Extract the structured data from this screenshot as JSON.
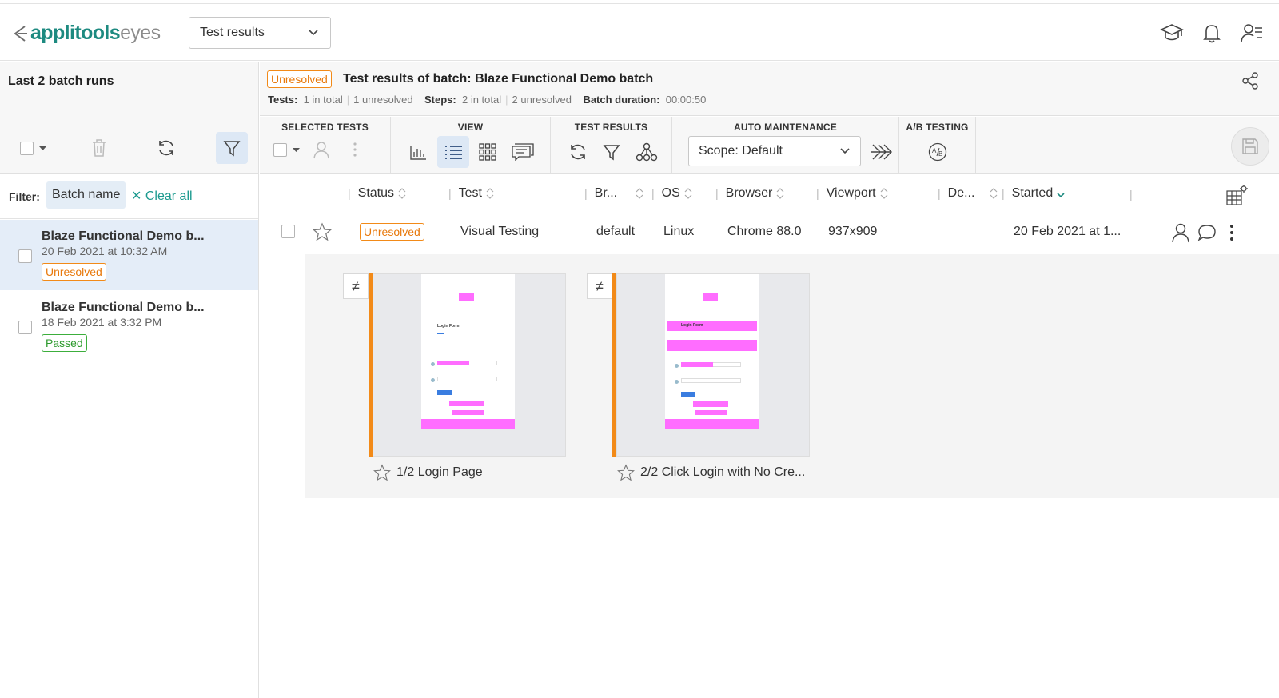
{
  "header": {
    "logo_primary": "applitools",
    "logo_secondary": "eyes",
    "page_selector": "Test results"
  },
  "left": {
    "title": "Last 2 batch runs",
    "filter_label": "Filter:",
    "filter_chip": "Batch name",
    "clear_all": "Clear all",
    "batches": [
      {
        "name": "Blaze Functional Demo b...",
        "date": "20 Feb 2021 at 10:32 AM",
        "status": "Unresolved"
      },
      {
        "name": "Blaze Functional Demo b...",
        "date": "18 Feb 2021 at 3:32 PM",
        "status": "Passed"
      }
    ]
  },
  "batch": {
    "status": "Unresolved",
    "title": "Test results of batch: Blaze Functional Demo batch",
    "tests_label": "Tests:",
    "tests_total": "1 in total",
    "tests_unresolved": "1 unresolved",
    "steps_label": "Steps:",
    "steps_total": "2 in total",
    "steps_unresolved": "2 unresolved",
    "duration_label": "Batch duration:",
    "duration": "00:00:50"
  },
  "toolbar": {
    "selected_tests": "SELECTED TESTS",
    "view": "VIEW",
    "test_results": "TEST RESULTS",
    "auto_maintenance": "AUTO MAINTENANCE",
    "ab_testing": "A/B TESTING",
    "scope": "Scope: Default"
  },
  "table": {
    "columns": [
      "Status",
      "Test",
      "Br...",
      "OS",
      "Browser",
      "Viewport",
      "De...",
      "Started"
    ],
    "row": {
      "status": "Unresolved",
      "test": "Visual Testing",
      "branch": "default",
      "os": "Linux",
      "browser": "Chrome 88.0",
      "viewport": "937x909",
      "started": "20 Feb 2021 at 1..."
    }
  },
  "steps": [
    {
      "caption": "1/2 Login Page",
      "thumb_title": "Login Form"
    },
    {
      "caption": "2/2 Click Login with No Cre...",
      "thumb_title": "Login Form"
    }
  ],
  "colors": {
    "brand": "#1d8a80",
    "unresolved": "#f28a18",
    "passed": "#3cae3c",
    "diff_highlight": "#ff6dff"
  }
}
